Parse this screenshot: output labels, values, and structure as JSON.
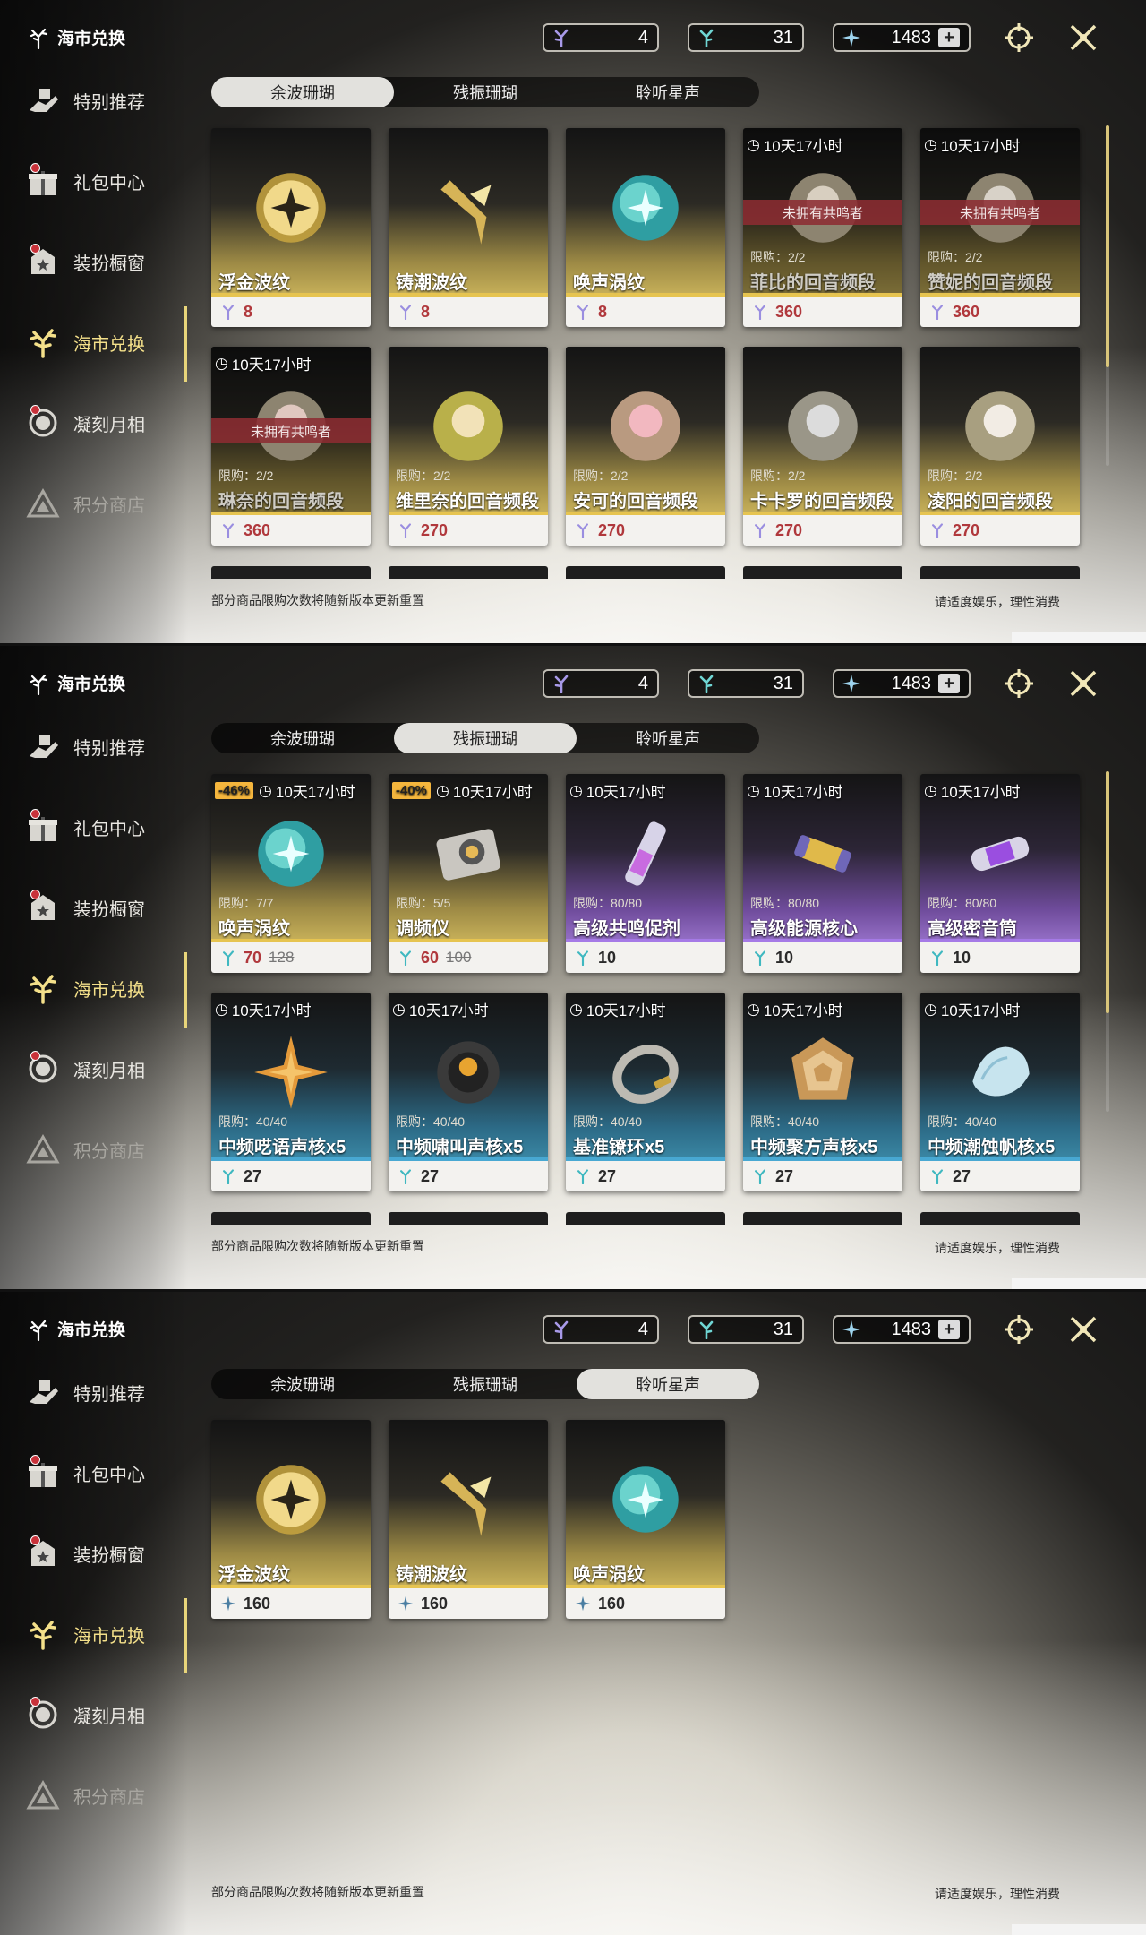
{
  "panels": [
    {
      "active_tab": 0
    },
    {
      "active_tab": 1
    },
    {
      "active_tab": 2
    }
  ],
  "brand": {
    "title": "海市兑换"
  },
  "sidebar": {
    "items": [
      {
        "label": "特别推荐",
        "icon": "hand-present-icon"
      },
      {
        "label": "礼包中心",
        "icon": "gift-icon"
      },
      {
        "label": "装扮橱窗",
        "icon": "outfit-icon"
      },
      {
        "label": "海市兑换",
        "icon": "coral-icon"
      },
      {
        "label": "凝刻月相",
        "icon": "moon-icon"
      },
      {
        "label": "积分商店",
        "icon": "triangle-icon"
      }
    ]
  },
  "currency": [
    {
      "icon": "coral-purple-icon",
      "value": "4"
    },
    {
      "icon": "coral-cyan-icon",
      "value": "31"
    },
    {
      "icon": "star-sound-icon",
      "value": "1483",
      "add": "+"
    }
  ],
  "tabs": [
    "余波珊瑚",
    "残振珊瑚",
    "聆听星声"
  ],
  "footer": {
    "note": "部分商品限购次数将随新版本更新重置",
    "tip": "请适度娱乐，理性消费"
  },
  "panel0": {
    "items": [
      {
        "name": "浮金波纹",
        "price": "8"
      },
      {
        "name": "铸潮波纹",
        "price": "8"
      },
      {
        "name": "唤声涡纹",
        "price": "8"
      },
      {
        "name": "菲比的回音频段",
        "price": "360",
        "timer": "10天17小时",
        "unowned": "未拥有共鸣者",
        "limit": "限购：2/2"
      },
      {
        "name": "赞妮的回音频段",
        "price": "360",
        "timer": "10天17小时",
        "unowned": "未拥有共鸣者",
        "limit": "限购：2/2"
      },
      {
        "name": "琳奈的回音频段",
        "price": "360",
        "timer": "10天17小时",
        "unowned": "未拥有共鸣者",
        "limit": "限购：2/2"
      },
      {
        "name": "维里奈的回音频段",
        "price": "270",
        "limit": "限购：2/2"
      },
      {
        "name": "安可的回音频段",
        "price": "270",
        "limit": "限购：2/2"
      },
      {
        "name": "卡卡罗的回音频段",
        "price": "270",
        "limit": "限购：2/2"
      },
      {
        "name": "凌阳的回音频段",
        "price": "270",
        "limit": "限购：2/2"
      }
    ]
  },
  "panel1": {
    "items": [
      {
        "name": "唤声涡纹",
        "price": "70",
        "old_price": "128",
        "discount": "-46%",
        "timer": "10天17小时",
        "limit": "限购：7/7"
      },
      {
        "name": "调频仪",
        "price": "60",
        "old_price": "100",
        "discount": "-40%",
        "timer": "10天17小时",
        "limit": "限购：5/5"
      },
      {
        "name": "高级共鸣促剂",
        "price": "10",
        "timer": "10天17小时",
        "limit": "限购：80/80"
      },
      {
        "name": "高级能源核心",
        "price": "10",
        "timer": "10天17小时",
        "limit": "限购：80/80"
      },
      {
        "name": "高级密音筒",
        "price": "10",
        "timer": "10天17小时",
        "limit": "限购：80/80"
      },
      {
        "name": "中频呓语声核x5",
        "price": "27",
        "timer": "10天17小时",
        "limit": "限购：40/40"
      },
      {
        "name": "中频啸叫声核x5",
        "price": "27",
        "timer": "10天17小时",
        "limit": "限购：40/40"
      },
      {
        "name": "基准镣环x5",
        "price": "27",
        "timer": "10天17小时",
        "limit": "限购：40/40"
      },
      {
        "name": "中频聚方声核x5",
        "price": "27",
        "timer": "10天17小时",
        "limit": "限购：40/40"
      },
      {
        "name": "中频潮蚀帆核x5",
        "price": "27",
        "timer": "10天17小时",
        "limit": "限购：40/40"
      }
    ]
  },
  "panel2": {
    "items": [
      {
        "name": "浮金波纹",
        "price": "160"
      },
      {
        "name": "铸潮波纹",
        "price": "160"
      },
      {
        "name": "唤声涡纹",
        "price": "160"
      }
    ]
  },
  "colors": {
    "accent_gold": "#e6c450",
    "accent_purple": "#a57ae6",
    "accent_blue": "#48a8d2",
    "unowned_red": "#8c2c32",
    "discount_orange": "#f5b63d"
  }
}
